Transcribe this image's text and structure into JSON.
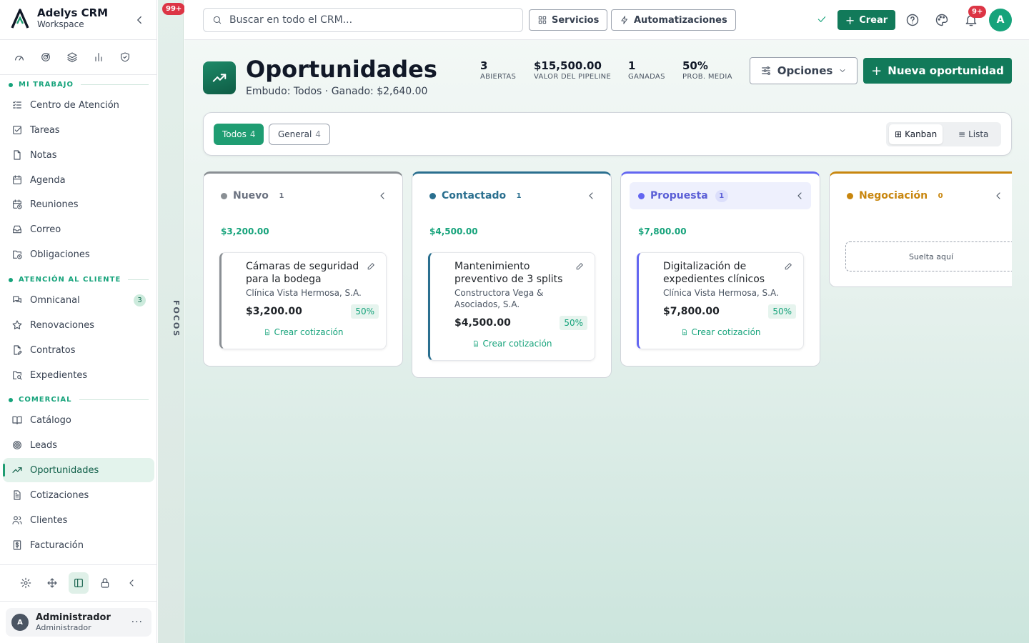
{
  "sidebar": {
    "brand": {
      "title": "Adelys CRM",
      "subtitle": "Workspace"
    },
    "quick_icons": [
      "gauge-icon",
      "target-icon",
      "layers-icon",
      "bar-chart-icon",
      "shield-check-icon"
    ],
    "sections": [
      {
        "label": "MI TRABAJO",
        "items": [
          {
            "label": "Centro de Atención",
            "icon": "list-check-icon"
          },
          {
            "label": "Tareas",
            "icon": "checkbox-icon"
          },
          {
            "label": "Notas",
            "icon": "file-icon"
          },
          {
            "label": "Agenda",
            "icon": "calendar-icon"
          },
          {
            "label": "Reuniones",
            "icon": "calendar-clock-icon"
          },
          {
            "label": "Correo",
            "icon": "inbox-icon"
          },
          {
            "label": "Obligaciones",
            "icon": "folder-clock-icon"
          }
        ]
      },
      {
        "label": "ATENCIÓN AL CLIENTE",
        "items": [
          {
            "label": "Omnicanal",
            "icon": "messages-icon",
            "count": "3"
          },
          {
            "label": "Renovaciones",
            "icon": "star-icon"
          },
          {
            "label": "Contratos",
            "icon": "file-signature-icon"
          },
          {
            "label": "Expedientes",
            "icon": "folder-search-icon"
          }
        ]
      },
      {
        "label": "COMERCIAL",
        "items": [
          {
            "label": "Catálogo",
            "icon": "book-open-icon"
          },
          {
            "label": "Leads",
            "icon": "target-icon"
          },
          {
            "label": "Oportunidades",
            "icon": "trending-up-icon",
            "active": true
          },
          {
            "label": "Cotizaciones",
            "icon": "file-text-icon"
          },
          {
            "label": "Clientes",
            "icon": "users-icon"
          },
          {
            "label": "Facturación",
            "icon": "receipt-icon"
          }
        ]
      }
    ],
    "tools": [
      "settings-icon",
      "move-icon",
      "panel-icon",
      "lock-icon",
      "chevron-left-icon"
    ],
    "user": {
      "initial": "A",
      "name": "Administrador",
      "role": "Administrador"
    }
  },
  "focus": {
    "badge": "99+",
    "label": "FOCOS"
  },
  "topbar": {
    "search_placeholder": "Buscar en todo el CRM...",
    "servicios": "Servicios",
    "automatizaciones": "Automatizaciones",
    "crear": "Crear",
    "notif_badge": "9+",
    "avatar": "A"
  },
  "header": {
    "title": "Oportunidades",
    "subtitle": "Embudo: Todos · Ganado: $2,640.00",
    "stats": [
      {
        "value": "3",
        "label": "ABIERTAS"
      },
      {
        "value": "$15,500.00",
        "label": "VALOR DEL PIPELINE"
      },
      {
        "value": "1",
        "label": "GANADAS"
      },
      {
        "value": "50%",
        "label": "PROB. MEDIA"
      }
    ],
    "opciones": "Opciones",
    "nueva": "Nueva oportunidad"
  },
  "filters": {
    "chips": [
      {
        "label": "Todos",
        "count": "4",
        "active": true
      },
      {
        "label": "General",
        "count": "4",
        "active": false
      }
    ],
    "views": {
      "kanban": "Kanban",
      "lista": "Lista"
    }
  },
  "kanban": {
    "columns": [
      {
        "name": "Nuevo",
        "count": "1",
        "color": "#8a8f94",
        "total": "$3,200.00",
        "cards": [
          {
            "title": "Cámaras de seguridad para la bodega",
            "company": "Clínica Vista Hermosa, S.A.",
            "amount": "$3,200.00",
            "prob": "50%",
            "action": "Crear cotización"
          }
        ]
      },
      {
        "name": "Contactado",
        "count": "1",
        "color": "#2a6f8f",
        "total": "$4,500.00",
        "cards": [
          {
            "title": "Mantenimiento preventivo de 3 splits",
            "company": "Constructora Vega & Asociados, S.A.",
            "amount": "$4,500.00",
            "prob": "50%",
            "action": "Crear cotización"
          }
        ]
      },
      {
        "name": "Propuesta",
        "count": "1",
        "color": "#6366f1",
        "total": "$7,800.00",
        "cards": [
          {
            "title": "Digitalización de expedientes clínicos",
            "company": "Clínica Vista Hermosa, S.A.",
            "amount": "$7,800.00",
            "prob": "50%",
            "action": "Crear cotización"
          }
        ]
      },
      {
        "name": "Negociación",
        "count": "0",
        "color": "#c8860e",
        "total": "",
        "drop": "Suelta aquí",
        "cards": []
      }
    ]
  }
}
